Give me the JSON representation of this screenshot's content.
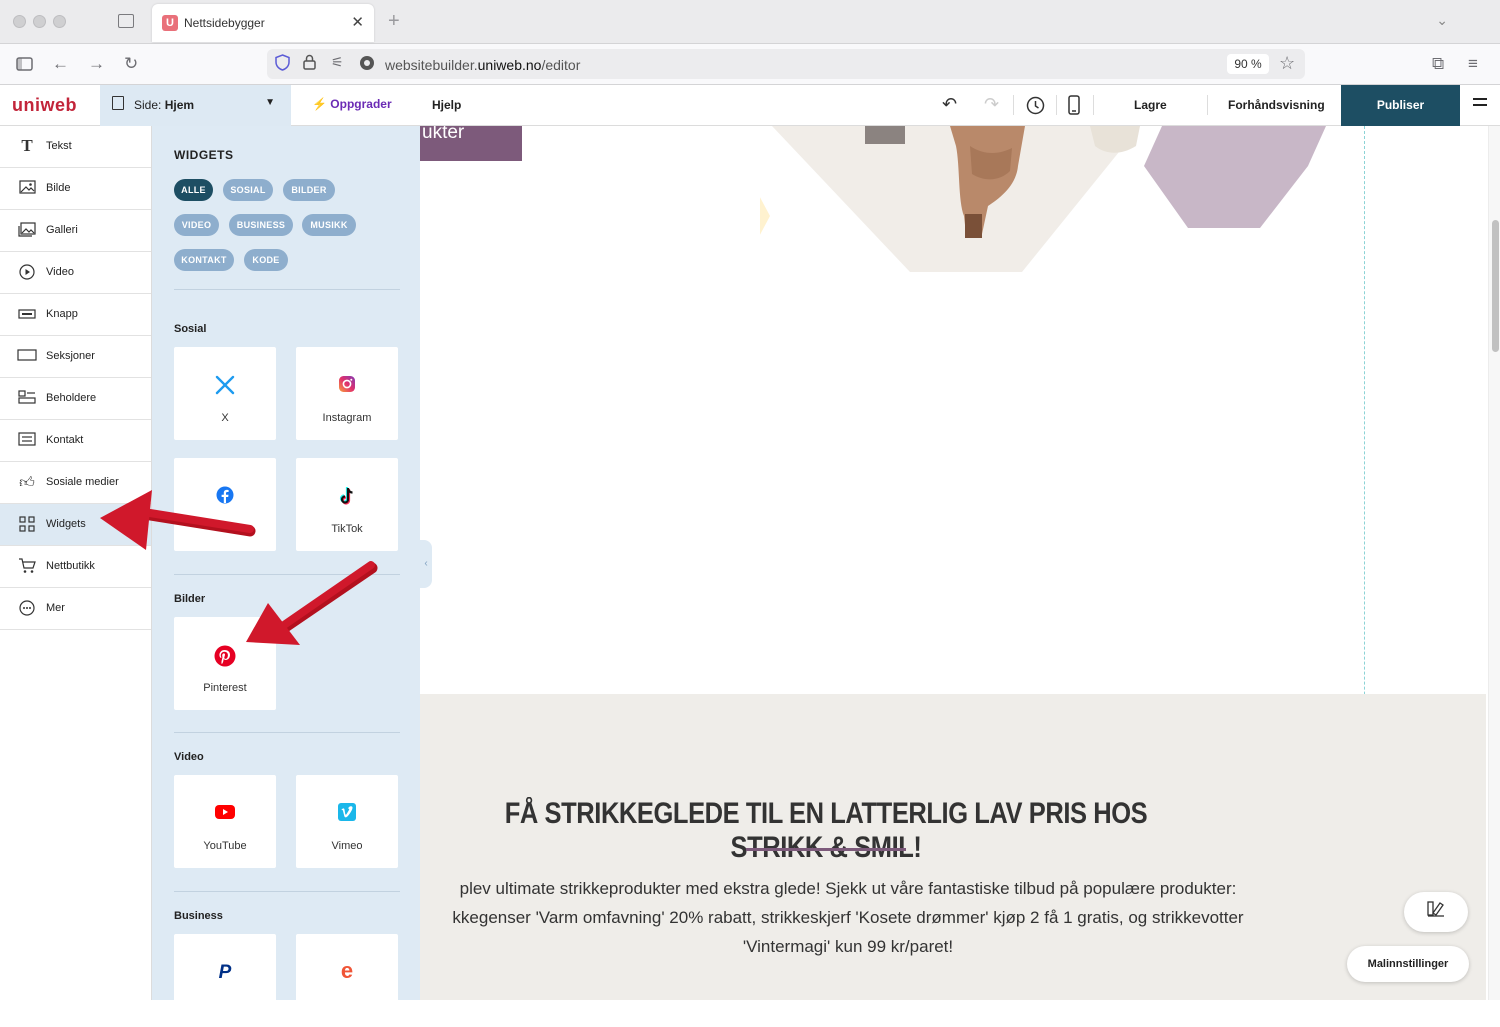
{
  "browser": {
    "tab_title": "Nettsidebygger",
    "url_prefix": "websitebuilder.",
    "url_domain": "uniweb.no",
    "url_path": "/editor",
    "zoom": "90 %"
  },
  "header": {
    "logo": "uniweb",
    "page_select_prefix": "Side: ",
    "page_select_value": "Hjem",
    "upgrade": "Oppgrader",
    "help": "Hjelp",
    "save": "Lagre",
    "preview": "Forhåndsvisning",
    "publish": "Publiser"
  },
  "sidebar": {
    "items": [
      {
        "label": "Tekst",
        "icon": "text-icon"
      },
      {
        "label": "Bilde",
        "icon": "image-icon"
      },
      {
        "label": "Galleri",
        "icon": "gallery-icon"
      },
      {
        "label": "Video",
        "icon": "video-icon"
      },
      {
        "label": "Knapp",
        "icon": "button-icon"
      },
      {
        "label": "Seksjoner",
        "icon": "sections-icon"
      },
      {
        "label": "Beholdere",
        "icon": "containers-icon"
      },
      {
        "label": "Kontakt",
        "icon": "contact-icon"
      },
      {
        "label": "Sosiale medier",
        "icon": "thumbs-up-icon"
      },
      {
        "label": "Widgets",
        "icon": "widgets-icon"
      },
      {
        "label": "Nettbutikk",
        "icon": "cart-icon"
      },
      {
        "label": "Mer",
        "icon": "more-icon"
      }
    ],
    "active": "Widgets"
  },
  "panel": {
    "title": "WIDGETS",
    "filters": [
      "ALLE",
      "SOSIAL",
      "BILDER",
      "VIDEO",
      "BUSINESS",
      "MUSIKK",
      "KONTAKT",
      "KODE"
    ],
    "active_filter": "ALLE",
    "sections": {
      "sosial": {
        "label": "Sosial",
        "items": [
          "X",
          "Instagram",
          "",
          "TikTok"
        ]
      },
      "bilder": {
        "label": "Bilder",
        "items": [
          "Pinterest"
        ]
      },
      "video": {
        "label": "Video",
        "items": [
          "YouTube",
          "Vimeo"
        ]
      },
      "business": {
        "label": "Business",
        "items": [
          "",
          ""
        ]
      }
    }
  },
  "canvas": {
    "hero_button_fragment": "ukter",
    "section_title": "FÅ STRIKKEGLEDE TIL EN LATTERLIG LAV PRIS HOS STRIKK & SMIL!",
    "section_body_line1": "plev ultimate strikkeprodukter med ekstra glede! Sjekk ut våre fantastiske tilbud på populære produkter:",
    "section_body_line2": "kkegenser 'Varm omfavning' 20% rabatt, strikkeskjerf 'Kosete drømmer' kjøp 2 få 1 gratis, og strikkevotter",
    "section_body_line3": "'Vintermagi' kun 99 kr/paret!",
    "template_settings": "Malinnstillinger"
  },
  "colors": {
    "publish": "#1d4e63",
    "accent_purple": "#7d5a7b",
    "panel_bg": "#deeaf4",
    "chip": "#8eaecd",
    "arrow": "#d0182b"
  }
}
